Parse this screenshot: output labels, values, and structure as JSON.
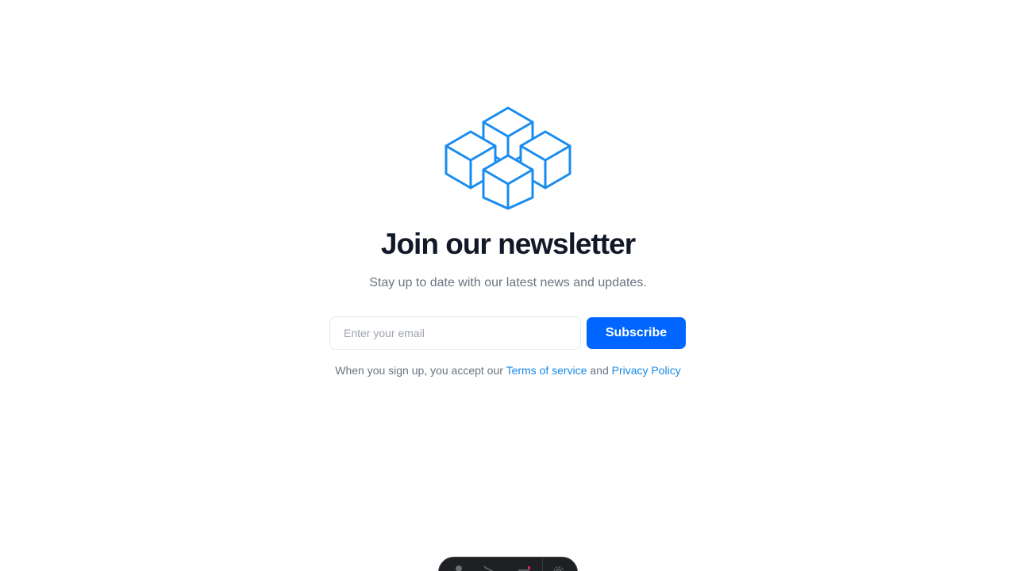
{
  "newsletter": {
    "title": "Join our newsletter",
    "subtitle": "Stay up to date with our latest news and updates.",
    "email_placeholder": "Enter your email",
    "email_value": "",
    "subscribe_label": "Subscribe"
  },
  "terms": {
    "prefix": "When you sign up, you accept our ",
    "terms_link": "Terms of service",
    "conjunction": " and ",
    "privacy_link": "Privacy Policy"
  },
  "colors": {
    "accent": "#0066ff",
    "logo": "#1a8cf0",
    "link": "#1588e8",
    "title": "#111827",
    "muted": "#6b7280"
  },
  "dock": {
    "icons": [
      "person-icon",
      "pointer-icon",
      "menu-icon",
      "settings-icon"
    ]
  }
}
